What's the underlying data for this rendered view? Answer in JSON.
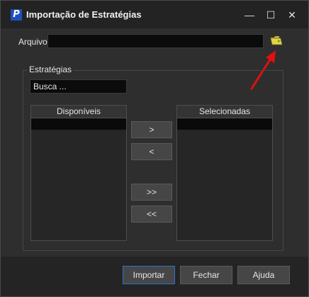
{
  "window": {
    "title": "Importação de Estratégias",
    "controls": {
      "minimize": "—",
      "maximize": "☐",
      "close": "✕"
    }
  },
  "arquivo": {
    "label": "Arquivo",
    "value": ""
  },
  "estrategias": {
    "group_title": "Estratégias",
    "search_value": "Busca ..."
  },
  "lists": {
    "available_header": "Disponíveis",
    "selected_header": "Selecionadas"
  },
  "transfer_buttons": {
    "add": ">",
    "remove": "<",
    "add_all": ">>",
    "remove_all": "<<"
  },
  "footer": {
    "import": "Importar",
    "close": "Fechar",
    "help": "Ajuda"
  },
  "colors": {
    "annotation_arrow": "#e01010",
    "primary_border": "#2f6fd6",
    "app_icon": "#1d4fbf"
  }
}
